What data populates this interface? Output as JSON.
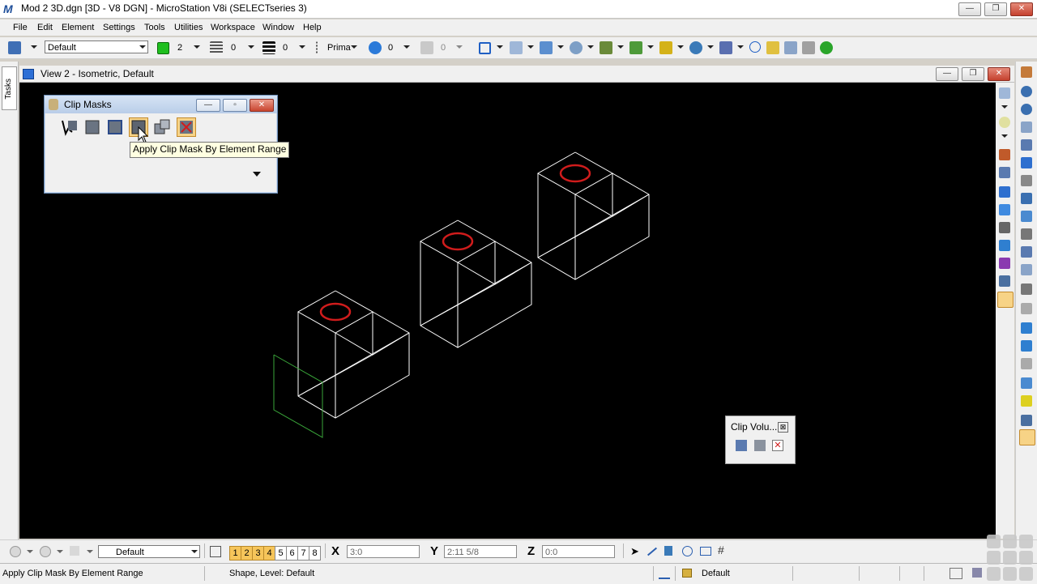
{
  "window": {
    "title": "Mod 2 3D.dgn [3D - V8 DGN] - MicroStation V8i (SELECTseries 3)",
    "app_icon": "M",
    "min": "—",
    "max": "❐",
    "close": "✕"
  },
  "menu": [
    "File",
    "Edit",
    "Element",
    "Settings",
    "Tools",
    "Utilities",
    "Workspace",
    "Window",
    "Help"
  ],
  "toolbar": {
    "level_combo": "Default",
    "color_value": "2",
    "style_value": "0",
    "weight_value": "0",
    "class_value": "Prima",
    "transparency_value": "0",
    "priority_value": "0",
    "accent_color": "#1fbf1f"
  },
  "tasks_tab": "Tasks",
  "view": {
    "title": "View 2 - Isometric, Default"
  },
  "clip_masks": {
    "title": "Clip Masks",
    "tooltip": "Apply Clip Mask By Element Range",
    "tool_icons": [
      "clip-mask-by-fence-icon",
      "clip-mask-by-element-icon",
      "clip-mask-by-shape-icon",
      "clip-mask-by-element-range-icon",
      "clip-mask-copy-icon",
      "clip-mask-clear-icon"
    ]
  },
  "clip_volume": {
    "title": "Clip Volu...",
    "close": "⊠"
  },
  "bottom": {
    "view_level_combo": "Default",
    "view_numbers": [
      "1",
      "2",
      "3",
      "4",
      "5",
      "6",
      "7",
      "8"
    ],
    "active_views": [
      "1",
      "2",
      "3",
      "4"
    ],
    "x_label": "X",
    "x_value": "3:0",
    "y_label": "Y",
    "y_value": "2:11 5/8",
    "z_label": "Z",
    "z_value": "0:0"
  },
  "status": {
    "prompt": "Apply Clip Mask By Element Range",
    "message": "Shape, Level: Default",
    "active_level": "Default"
  },
  "colors": {
    "canvas": "#000000",
    "wire": "#ffffff",
    "circle": "#d01c1c",
    "clip_shape": "#3aa63a"
  }
}
